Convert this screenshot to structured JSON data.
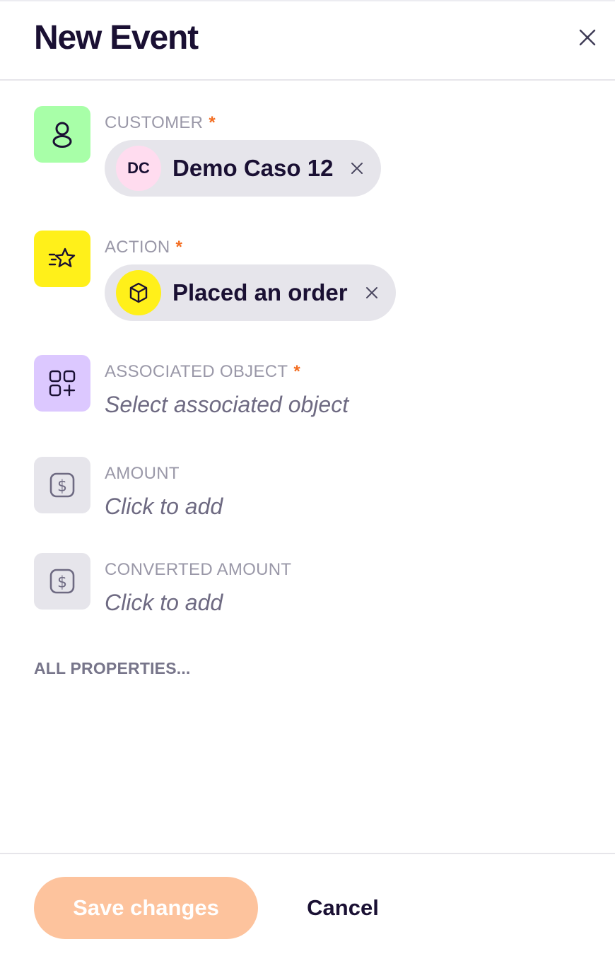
{
  "header": {
    "title": "New Event"
  },
  "fields": {
    "customer": {
      "label": "CUSTOMER",
      "required_mark": "*",
      "icon": "user-icon",
      "icon_bg": "#a8ffa8",
      "chip": {
        "initials": "DC",
        "name": "Demo Caso 12",
        "avatar_bg": "#ffdcef"
      }
    },
    "action": {
      "label": "ACTION",
      "required_mark": "*",
      "icon": "star-speed-icon",
      "icon_bg": "#fff01a",
      "chip": {
        "name": "Placed an order",
        "icon": "box-icon",
        "avatar_bg": "#fff01a"
      }
    },
    "associated_object": {
      "label": "ASSOCIATED OBJECT",
      "required_mark": "*",
      "icon": "apps-add-icon",
      "icon_bg": "#dcc8ff",
      "placeholder": "Select associated object"
    },
    "amount": {
      "label": "AMOUNT",
      "icon": "dollar-icon",
      "icon_bg": "#e6e5eb",
      "placeholder": "Click to add"
    },
    "converted_amount": {
      "label": "CONVERTED AMOUNT",
      "icon": "dollar-icon",
      "icon_bg": "#e6e5eb",
      "placeholder": "Click to add"
    }
  },
  "all_properties_label": "ALL PROPERTIES...",
  "footer": {
    "save_label": "Save changes",
    "cancel_label": "Cancel",
    "save_color": "#fdc39d"
  },
  "colors": {
    "text_primary": "#1a1033",
    "label": "#9a98a8",
    "required": "#f36d21"
  }
}
